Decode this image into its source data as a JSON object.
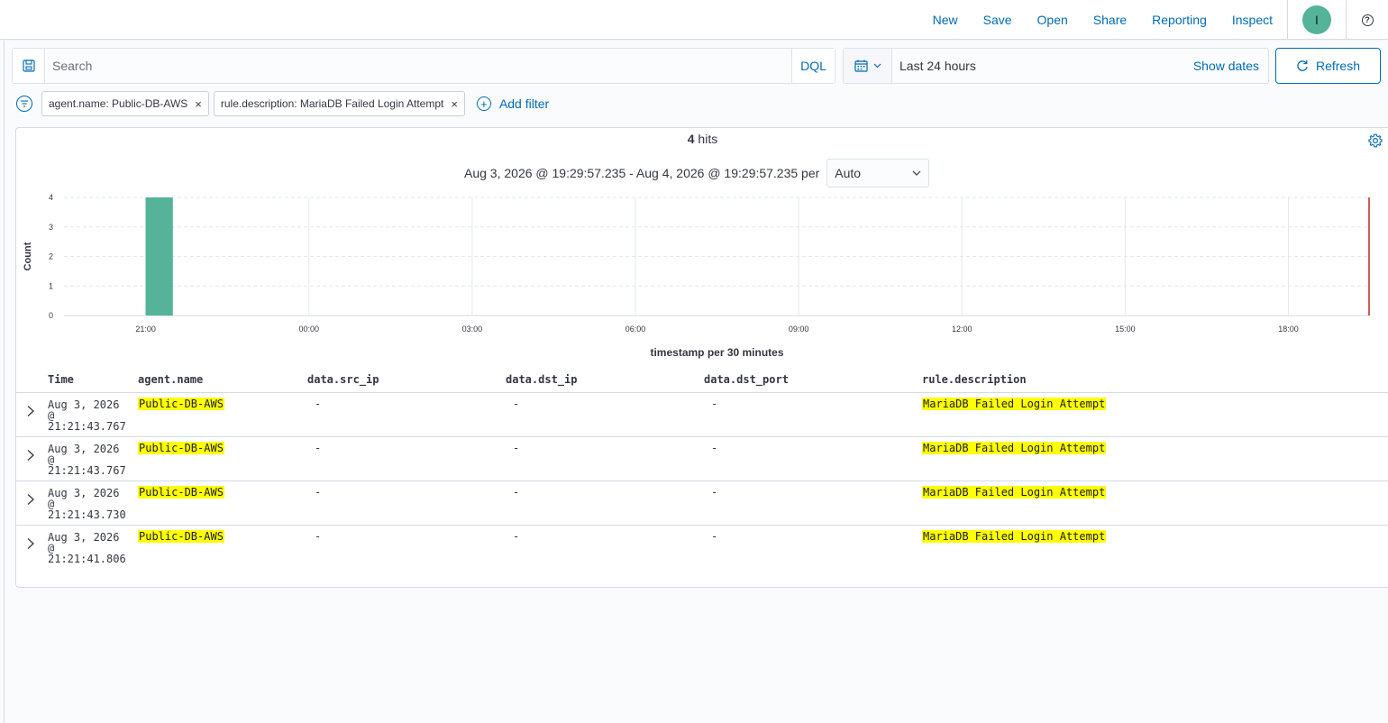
{
  "topnav": {
    "items": [
      "New",
      "Save",
      "Open",
      "Share",
      "Reporting",
      "Inspect"
    ],
    "avatar_initial": "I",
    "help_glyph": "?"
  },
  "query": {
    "placeholder": "Search",
    "language": "DQL"
  },
  "datepicker": {
    "range_label": "Last 24 hours",
    "show_dates": "Show dates",
    "refresh": "Refresh"
  },
  "filters": {
    "pills": [
      "agent.name: Public-DB-AWS",
      "rule.description: MariaDB Failed Login Attempt"
    ],
    "add_filter": "Add filter"
  },
  "summary": {
    "hits_count": "4",
    "hits_label": " hits",
    "range_text": "Aug 3, 2026 @ 19:29:57.235 - Aug 4, 2026 @ 19:29:57.235 per",
    "interval": "Auto"
  },
  "chart_data": {
    "type": "bar",
    "ylabel": "Count",
    "xlabel": "timestamp per 30 minutes",
    "ylim": [
      0,
      4
    ],
    "yticks": [
      "0",
      "1",
      "2",
      "3",
      "4"
    ],
    "xticks": [
      "21:00",
      "00:00",
      "03:00",
      "06:00",
      "09:00",
      "12:00",
      "15:00",
      "18:00"
    ],
    "x_start": "19:29:57.235",
    "x_end": "19:29:57.235",
    "bars": [
      {
        "bucket": "21:00",
        "value": 4
      }
    ],
    "bar_color": "#54b399",
    "now_marker_color": "#bd271e",
    "grid": true
  },
  "table": {
    "columns": [
      "Time",
      "agent.name",
      "data.src_ip",
      "data.dst_ip",
      "data.dst_port",
      "rule.description"
    ],
    "rows": [
      {
        "time": "Aug 3, 2026 @ 21:21:43.767",
        "agent": "Public-DB-AWS",
        "src_ip": "-",
        "dst_ip": "-",
        "dst_port": "-",
        "rule": "MariaDB Failed Login Attempt"
      },
      {
        "time": "Aug 3, 2026 @ 21:21:43.767",
        "agent": "Public-DB-AWS",
        "src_ip": "-",
        "dst_ip": "-",
        "dst_port": "-",
        "rule": "MariaDB Failed Login Attempt"
      },
      {
        "time": "Aug 3, 2026 @ 21:21:43.730",
        "agent": "Public-DB-AWS",
        "src_ip": "-",
        "dst_ip": "-",
        "dst_port": "-",
        "rule": "MariaDB Failed Login Attempt"
      },
      {
        "time": "Aug 3, 2026 @ 21:21:41.806",
        "agent": "Public-DB-AWS",
        "src_ip": "-",
        "dst_ip": "-",
        "dst_port": "-",
        "rule": "MariaDB Failed Login Attempt"
      }
    ]
  },
  "colors": {
    "link": "#006bb8",
    "highlight": "#ffff00"
  }
}
